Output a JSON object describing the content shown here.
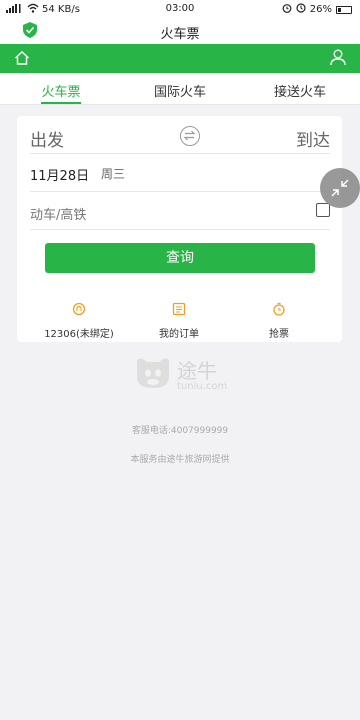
{
  "status_bar": {
    "speed": "54 KB/s",
    "time": "03:00",
    "battery": "26%"
  },
  "app": {
    "title": "火车票"
  },
  "tabs": [
    {
      "label": "火车票",
      "active": true
    },
    {
      "label": "国际火车",
      "active": false
    },
    {
      "label": "接送火车",
      "active": false
    }
  ],
  "search": {
    "from_label": "出发",
    "to_label": "到达",
    "date": "11月28日",
    "weekday": "周三",
    "train_type_label": "动车/高铁",
    "train_type_checked": false,
    "button_label": "查询"
  },
  "shortcuts": [
    {
      "label": "12306(未绑定)",
      "icon": "12306-icon"
    },
    {
      "label": "我的订单",
      "icon": "order-icon"
    },
    {
      "label": "抢票",
      "icon": "timer-icon"
    }
  ],
  "brand": {
    "name_cn": "途牛",
    "name_en": "tuniu.com"
  },
  "footer": {
    "phone_line": "客服电话:4007999999",
    "provider_line": "本服务由途牛旅游网提供"
  },
  "colors": {
    "accent": "#28b446",
    "shortcut_icon": "#f0a020"
  }
}
